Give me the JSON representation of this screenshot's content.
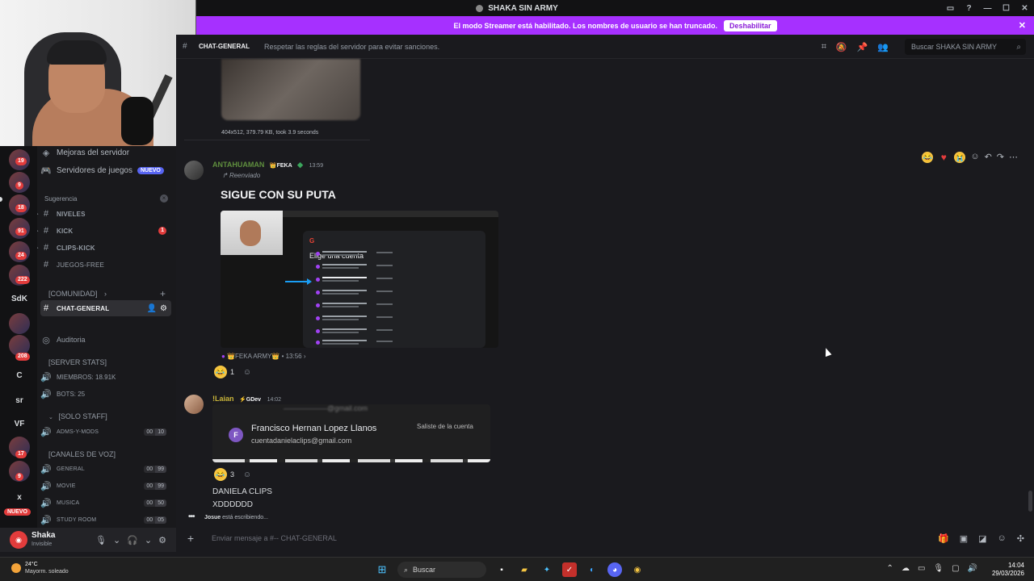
{
  "window": {
    "title": "SHAKA SIN ARMY"
  },
  "banner": {
    "text": "El modo Streamer está habilitado. Los nombres de usuario se han truncado.",
    "button": "Deshabilitar"
  },
  "rail": {
    "servers": [
      {
        "label": "",
        "badge": "19",
        "kind": "img"
      },
      {
        "label": "",
        "badge": "9",
        "kind": "img"
      },
      {
        "label": "",
        "badge": "18",
        "kind": "img"
      },
      {
        "label": "",
        "badge": "91",
        "kind": "img"
      },
      {
        "label": "",
        "badge": "24",
        "kind": "img"
      },
      {
        "label": "",
        "badge": "222",
        "kind": "img"
      },
      {
        "label": "SdK",
        "badge": "",
        "kind": "txt"
      },
      {
        "label": "",
        "badge": "",
        "kind": "img"
      },
      {
        "label": "",
        "badge": "208",
        "kind": "img"
      },
      {
        "label": "C",
        "badge": "",
        "kind": "txt"
      },
      {
        "label": "sr",
        "badge": "",
        "kind": "txt"
      },
      {
        "label": "VF",
        "badge": "",
        "kind": "txt"
      },
      {
        "label": "",
        "badge": "17",
        "kind": "img"
      },
      {
        "label": "",
        "badge": "9",
        "kind": "img"
      },
      {
        "label": "x",
        "badge": "",
        "kind": "txt"
      }
    ],
    "nuevo": "NUEVO"
  },
  "sidebar": {
    "mejoras": "Mejoras del servidor",
    "servidores_juegos": "Servidores de juegos",
    "nuevo_pill": "NUEVO",
    "sugerencia": "Sugerencia",
    "channels_top": [
      {
        "name": "NIVELES",
        "badge": ""
      },
      {
        "name": "KICK",
        "badge": "1"
      },
      {
        "name": "CLIPS-KICK",
        "badge": ""
      },
      {
        "name": "JUEGOS-FREE",
        "badge": ""
      }
    ],
    "cat_comunidad": "[COMUNIDAD]",
    "chat_general": "CHAT-GENERAL",
    "auditoria": "Auditoria",
    "cat_server_stats": "[SERVER STATS]",
    "miembros": "MIEMBROS: 18.91k",
    "bots": "BOTS: 25",
    "cat_solo_staff": "[SOLO STAFF]",
    "adms": "ADMS-Y-MODS",
    "adms_cnt": [
      "00",
      "10"
    ],
    "cat_canales_voz": "[CANALES DE VOZ]",
    "voice": [
      {
        "name": "GENERAL",
        "a": "00",
        "b": "99"
      },
      {
        "name": "MOVIE",
        "a": "00",
        "b": "99"
      },
      {
        "name": "MUSICA",
        "a": "00",
        "b": "50"
      },
      {
        "name": "STUDY ROOM",
        "a": "00",
        "b": "05"
      }
    ]
  },
  "user": {
    "name": "Shaka",
    "status": "Invisible"
  },
  "channel": {
    "name": "CHAT-GENERAL",
    "topic": "Respetar las reglas del servidor para evitar sanciones.",
    "search_placeholder": "Buscar SHAKA SIN ARMY"
  },
  "messages": {
    "img_meta": "404x512, 379.79 KB, took 3.9 seconds",
    "m1": {
      "author": "ANTAHUAMAN",
      "tag": "FEKA",
      "time": "13:59",
      "forward": "Reenviado",
      "text": "SIGUE CON SU PUTA",
      "shot_title": "Elige una cuenta",
      "footer": "FEKA ARMY",
      "footer_time": "13:56",
      "reaction_count": "1"
    },
    "m2": {
      "author": "!Laian",
      "tag": "GDev",
      "time": "14:02",
      "shot_name": "Francisco Hernan Lopez Llanos",
      "shot_email": "cuentadanielaclips@gmail.com",
      "shot_status": "Saliste de la cuenta",
      "reaction_count": "3",
      "line1": "DANIELA CLIPS",
      "line2": "XDDDDDD"
    },
    "typing_user": "Josue",
    "typing_text": "está escribiendo..."
  },
  "composer": {
    "placeholder": "Enviar mensaje a #-- CHAT-GENERAL"
  },
  "taskbar": {
    "temp": "24°C",
    "weather": "Mayorm. soleado",
    "search": "Buscar",
    "time": "14:04",
    "date": "29/03/2026"
  },
  "colors": {
    "accent": "#5865f2",
    "banner": "#a630ff",
    "author1": "#5f8f3e",
    "author2": "#c8b43a"
  }
}
